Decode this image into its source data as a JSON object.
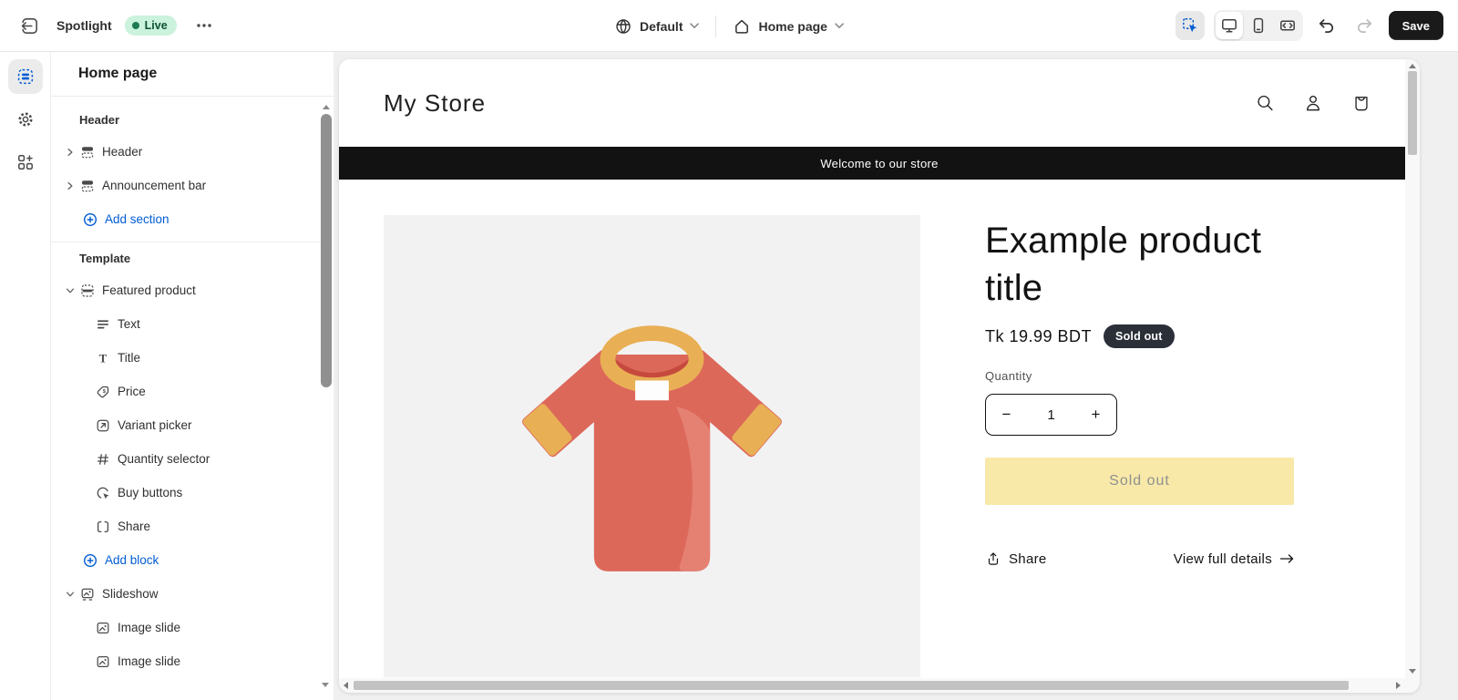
{
  "topbar": {
    "theme_name": "Spotlight",
    "live_badge": "Live",
    "locale_selector": "Default",
    "page_selector": "Home page",
    "save_label": "Save"
  },
  "sidebar": {
    "title": "Home page",
    "header_group": {
      "label": "Header",
      "items": [
        {
          "label": "Header"
        },
        {
          "label": "Announcement bar"
        }
      ],
      "add_action": "Add section"
    },
    "template_group": {
      "label": "Template",
      "featured_product": {
        "label": "Featured product",
        "blocks": [
          "Text",
          "Title",
          "Price",
          "Variant picker",
          "Quantity selector",
          "Buy buttons",
          "Share"
        ],
        "add_action": "Add block"
      },
      "slideshow": {
        "label": "Slideshow",
        "blocks": [
          "Image slide",
          "Image slide"
        ]
      }
    }
  },
  "preview": {
    "store_name": "My Store",
    "announcement": "Welcome to our store",
    "product": {
      "title": "Example product title",
      "price": "Tk 19.99 BDT",
      "availability_badge": "Sold out",
      "quantity_label": "Quantity",
      "quantity_value": "1",
      "decrease_label": "−",
      "increase_label": "+",
      "add_to_cart_label": "Sold out",
      "share_label": "Share",
      "details_link_label": "View full details"
    }
  },
  "colors": {
    "accent_blue": "#005bd3",
    "live_badge_bg": "#cbf2dc",
    "live_badge_text": "#0c5132",
    "save_button_bg": "#1a1a1a",
    "announcement_bg": "#121212",
    "sold_out_badge_bg": "#2a2f38",
    "sold_out_button_bg": "#f8e9a9",
    "product_media_bg": "#f2f2f2",
    "tshirt_red": "#dc685a",
    "tshirt_trim": "#e9af55"
  }
}
